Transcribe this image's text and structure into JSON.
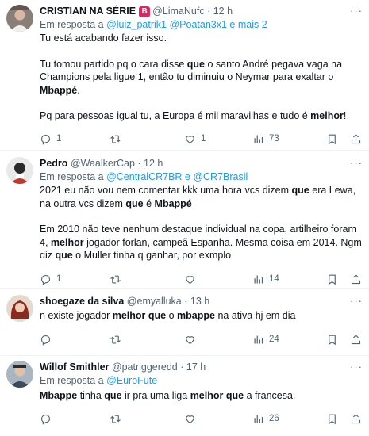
{
  "tweets": [
    {
      "name": "CRISTIAN NA SÉRIE",
      "badge": "B",
      "handle": "@LimaNufc",
      "time": "12 h",
      "reply_prefix": "Em resposta a",
      "reply_mentions": "@luiz_patrik1 @Poatan3x1 e mais 2",
      "paragraphs": [
        "Tu está acabando fazer isso.",
        "Tu tomou partido pq o cara disse **que** o santo André pegava vaga na Champions pela ligue 1, então tu diminuiu o Neymar para exaltar o **Mbappé**.",
        "Pq para pessoas igual tu, a Europa é mil maravilhas e tudo é **melhor**!"
      ],
      "replies": "1",
      "retweets": "",
      "likes": "1",
      "views": "73"
    },
    {
      "name": "Pedro",
      "handle": "@WaalkerCap",
      "time": "12 h",
      "reply_prefix": "Em resposta a",
      "reply_mentions": "@CentralCR7BR e @CR7Brasil",
      "paragraphs": [
        "2021 eu não vou nem comentar kkk uma hora vcs dizem **que** era Lewa, na outra vcs dizem **que** é **Mbappé**",
        "Em 2010 não teve nenhum destaque individual na copa, artilheiro foram 4, **melhor** jogador forlan, campeã Espanha. Mesma coisa em 2014. Ngm diz **que** o Muller tinha q ganhar, por exmplo"
      ],
      "replies": "1",
      "retweets": "",
      "likes": "",
      "views": "14"
    },
    {
      "name": "shoegaze da silva",
      "handle": "@emyalluka",
      "time": "13 h",
      "paragraphs": [
        "n existe jogador **melhor** **que** o **mbappe** na ativa hj em dia"
      ],
      "replies": "",
      "retweets": "",
      "likes": "",
      "views": "24"
    },
    {
      "name": "Willof Smithler",
      "handle": "@patriggeredd",
      "time": "17 h",
      "reply_prefix": "Em resposta a",
      "reply_mentions": "@EuroFute",
      "paragraphs": [
        "**Mbappe** tinha **que** ir pra uma liga **melhor** **que** a francesa."
      ],
      "replies": "",
      "retweets": "",
      "likes": "",
      "views": "26"
    }
  ],
  "colors": {
    "text": "#0f1419",
    "secondary": "#536471",
    "link": "#1d9bf0",
    "badge": "#e0245e",
    "divider": "#eff3f4"
  },
  "icons": [
    "reply-icon",
    "retweet-icon",
    "like-icon",
    "views-icon",
    "bookmark-icon",
    "share-icon",
    "more-icon"
  ]
}
